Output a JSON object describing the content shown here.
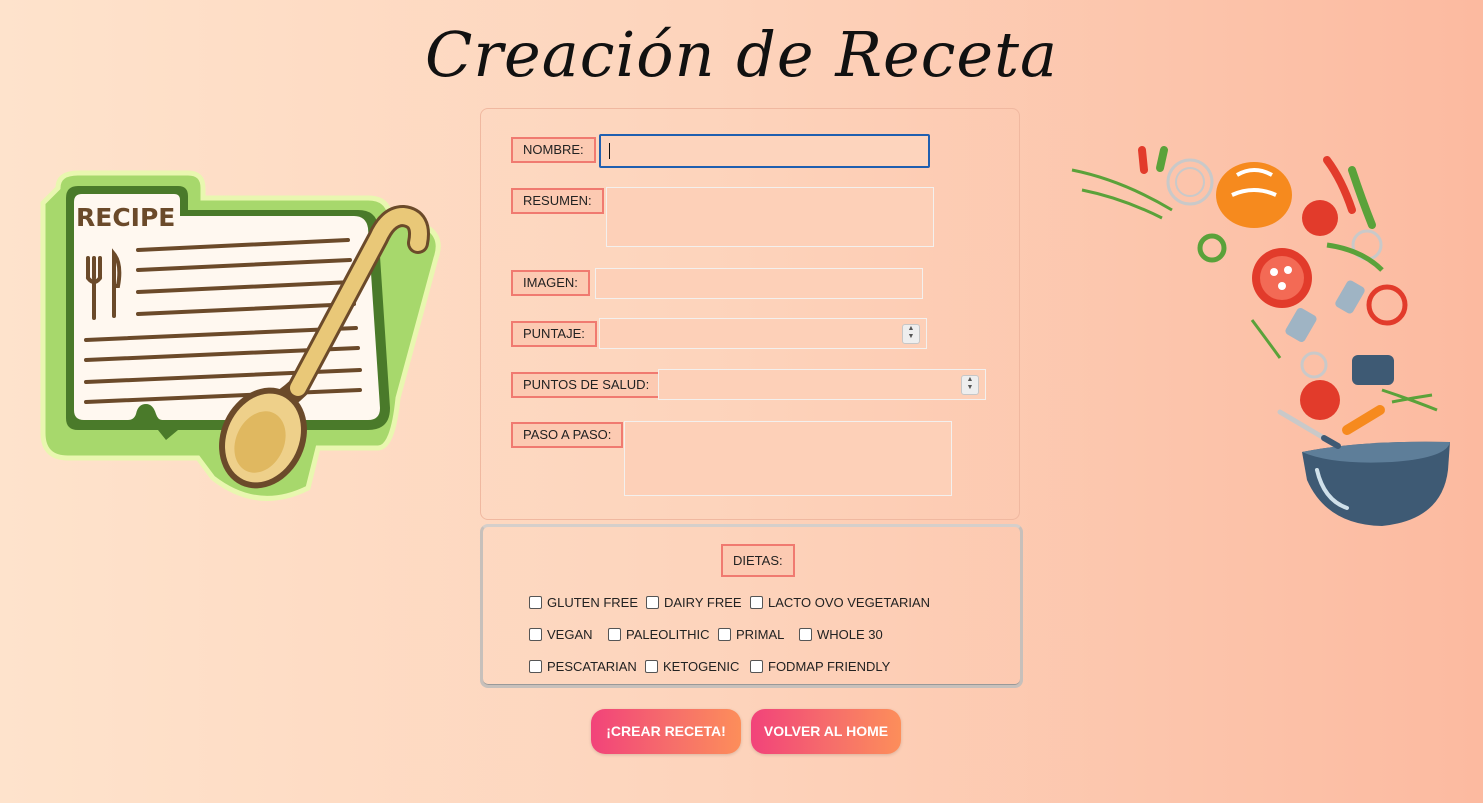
{
  "page": {
    "title": "Creación de Receta"
  },
  "left_illustration": {
    "text": "RECIPE",
    "icon": "recipe-card-with-spoon"
  },
  "right_illustration": {
    "icon": "vegetables-falling-into-bowl"
  },
  "form": {
    "nombre": {
      "label": "NOMBRE:",
      "value": ""
    },
    "resumen": {
      "label": "RESUMEN:",
      "value": ""
    },
    "imagen": {
      "label": "IMAGEN:",
      "value": ""
    },
    "puntaje": {
      "label": "PUNTAJE:",
      "value": ""
    },
    "puntos_salud": {
      "label": "PUNTOS DE SALUD:",
      "value": ""
    },
    "paso_a_paso": {
      "label": "PASO A PASO:",
      "value": ""
    }
  },
  "diets": {
    "title": "DIETAS:",
    "options": [
      {
        "label": "GLUTEN FREE",
        "checked": false
      },
      {
        "label": "DAIRY FREE",
        "checked": false
      },
      {
        "label": "LACTO OVO VEGETARIAN",
        "checked": false
      },
      {
        "label": "VEGAN",
        "checked": false
      },
      {
        "label": "PALEOLITHIC",
        "checked": false
      },
      {
        "label": "PRIMAL",
        "checked": false
      },
      {
        "label": "WHOLE 30",
        "checked": false
      },
      {
        "label": "PESCATARIAN",
        "checked": false
      },
      {
        "label": "KETOGENIC",
        "checked": false
      },
      {
        "label": "FODMAP FRIENDLY",
        "checked": false
      }
    ]
  },
  "buttons": {
    "create": "¡CREAR RECETA!",
    "home": "VOLVER AL HOME"
  },
  "colors": {
    "accent": "#f07a70",
    "button_start": "#f2437a",
    "button_end": "#fd8e5a",
    "focus": "#1f5fb0"
  }
}
